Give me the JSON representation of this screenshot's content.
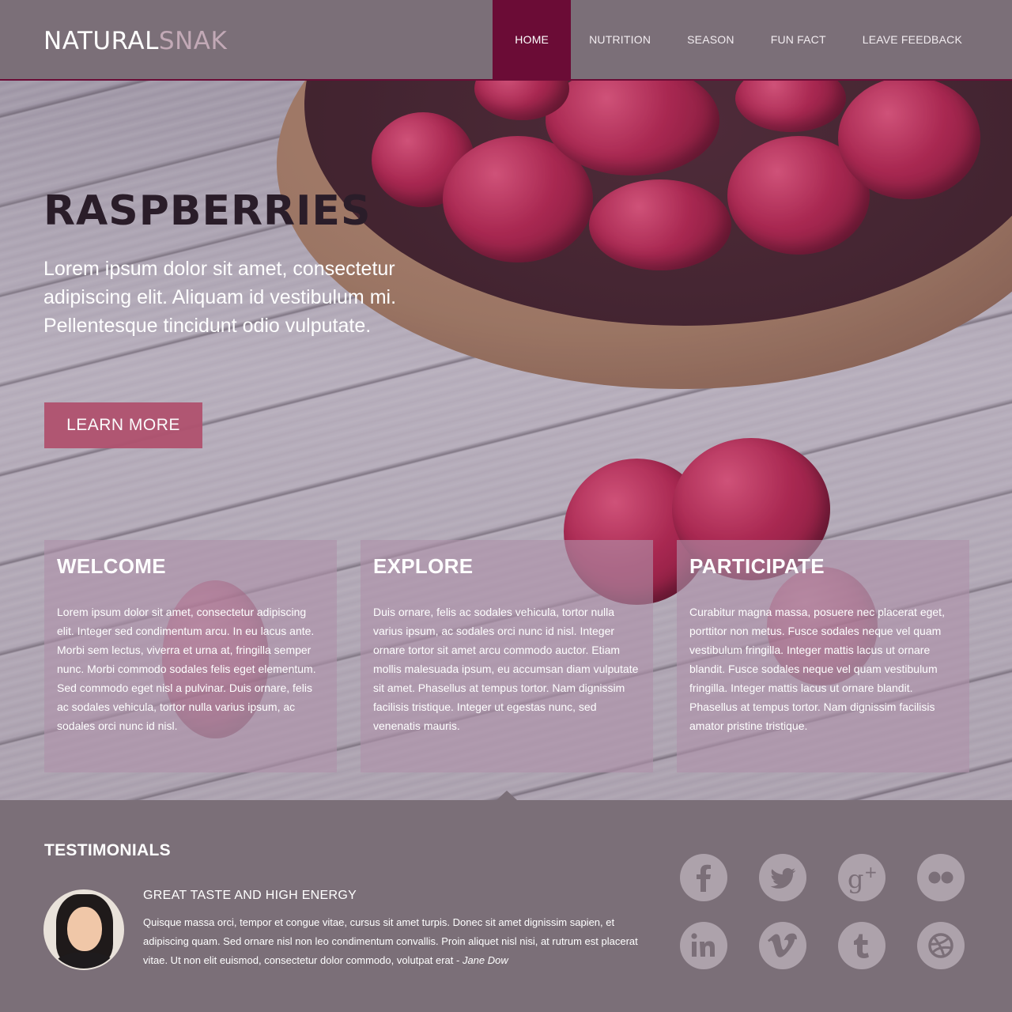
{
  "brand": {
    "part1": "NATURAL",
    "part2": "SNAK"
  },
  "nav": {
    "items": [
      {
        "label": "HOME",
        "active": true
      },
      {
        "label": "NUTRITION",
        "active": false
      },
      {
        "label": "SEASON",
        "active": false
      },
      {
        "label": "FUN FACT",
        "active": false
      },
      {
        "label": "LEAVE FEEDBACK",
        "active": false
      }
    ]
  },
  "hero": {
    "title": "RASPBERRIES",
    "lead": "Lorem ipsum dolor sit amet, consectetur adipiscing elit. Aliquam id vestibulum mi. Pellentesque tincidunt odio vulputate.",
    "cta": "LEARN MORE"
  },
  "cards": [
    {
      "title": "WELCOME",
      "body": "Lorem ipsum dolor sit amet, consectetur adipiscing elit. Integer sed condimentum arcu. In eu lacus ante. Morbi sem lectus, viverra et urna at, fringilla semper nunc. Morbi commodo sodales felis eget elementum. Sed commodo eget nisl a pulvinar. Duis ornare, felis ac sodales vehicula, tortor nulla varius ipsum, ac sodales orci nunc id nisl."
    },
    {
      "title": "EXPLORE",
      "body": "Duis ornare, felis ac sodales vehicula, tortor nulla varius ipsum, ac sodales orci nunc id nisl. Integer ornare tortor sit amet arcu commodo auctor. Etiam mollis malesuada ipsum, eu accumsan diam vulputate sit amet. Phasellus at tempus tortor. Nam dignissim facilisis tristique. Integer ut egestas nunc, sed venenatis mauris."
    },
    {
      "title": "PARTICIPATE",
      "body": "Curabitur magna massa, posuere nec placerat eget, porttitor non metus. Fusce sodales neque vel quam vestibulum fringilla. Integer mattis lacus ut ornare blandit. Fusce sodales neque vel quam vestibulum fringilla. Integer mattis lacus ut ornare blandit. Phasellus at tempus tortor. Nam dignissim facilisis amator pristine tristique."
    }
  ],
  "testimonials": {
    "heading": "TESTIMONIALS",
    "title": "GREAT TASTE AND HIGH ENERGY",
    "body": "Quisque massa orci, tempor et congue vitae, cursus sit amet turpis. Donec sit amet dignissim sapien, et adipiscing quam. Sed ornare nisl non leo condimentum convallis. Proin aliquet nisl nisi, at rutrum est placerat vitae. Ut non elit euismod, consectetur dolor commodo, volutpat erat -",
    "author": "Jane Dow"
  },
  "social": {
    "icons": [
      "facebook-icon",
      "twitter-icon",
      "google-plus-icon",
      "flickr-icon",
      "linkedin-icon",
      "vimeo-icon",
      "tumblr-icon",
      "dribbble-icon"
    ],
    "icon_bg": "#ada2ab",
    "icon_fg": "#7b6f78"
  },
  "colors": {
    "accent": "#6b0c36",
    "button": "#b0526f",
    "bar": "#7b6f78"
  }
}
